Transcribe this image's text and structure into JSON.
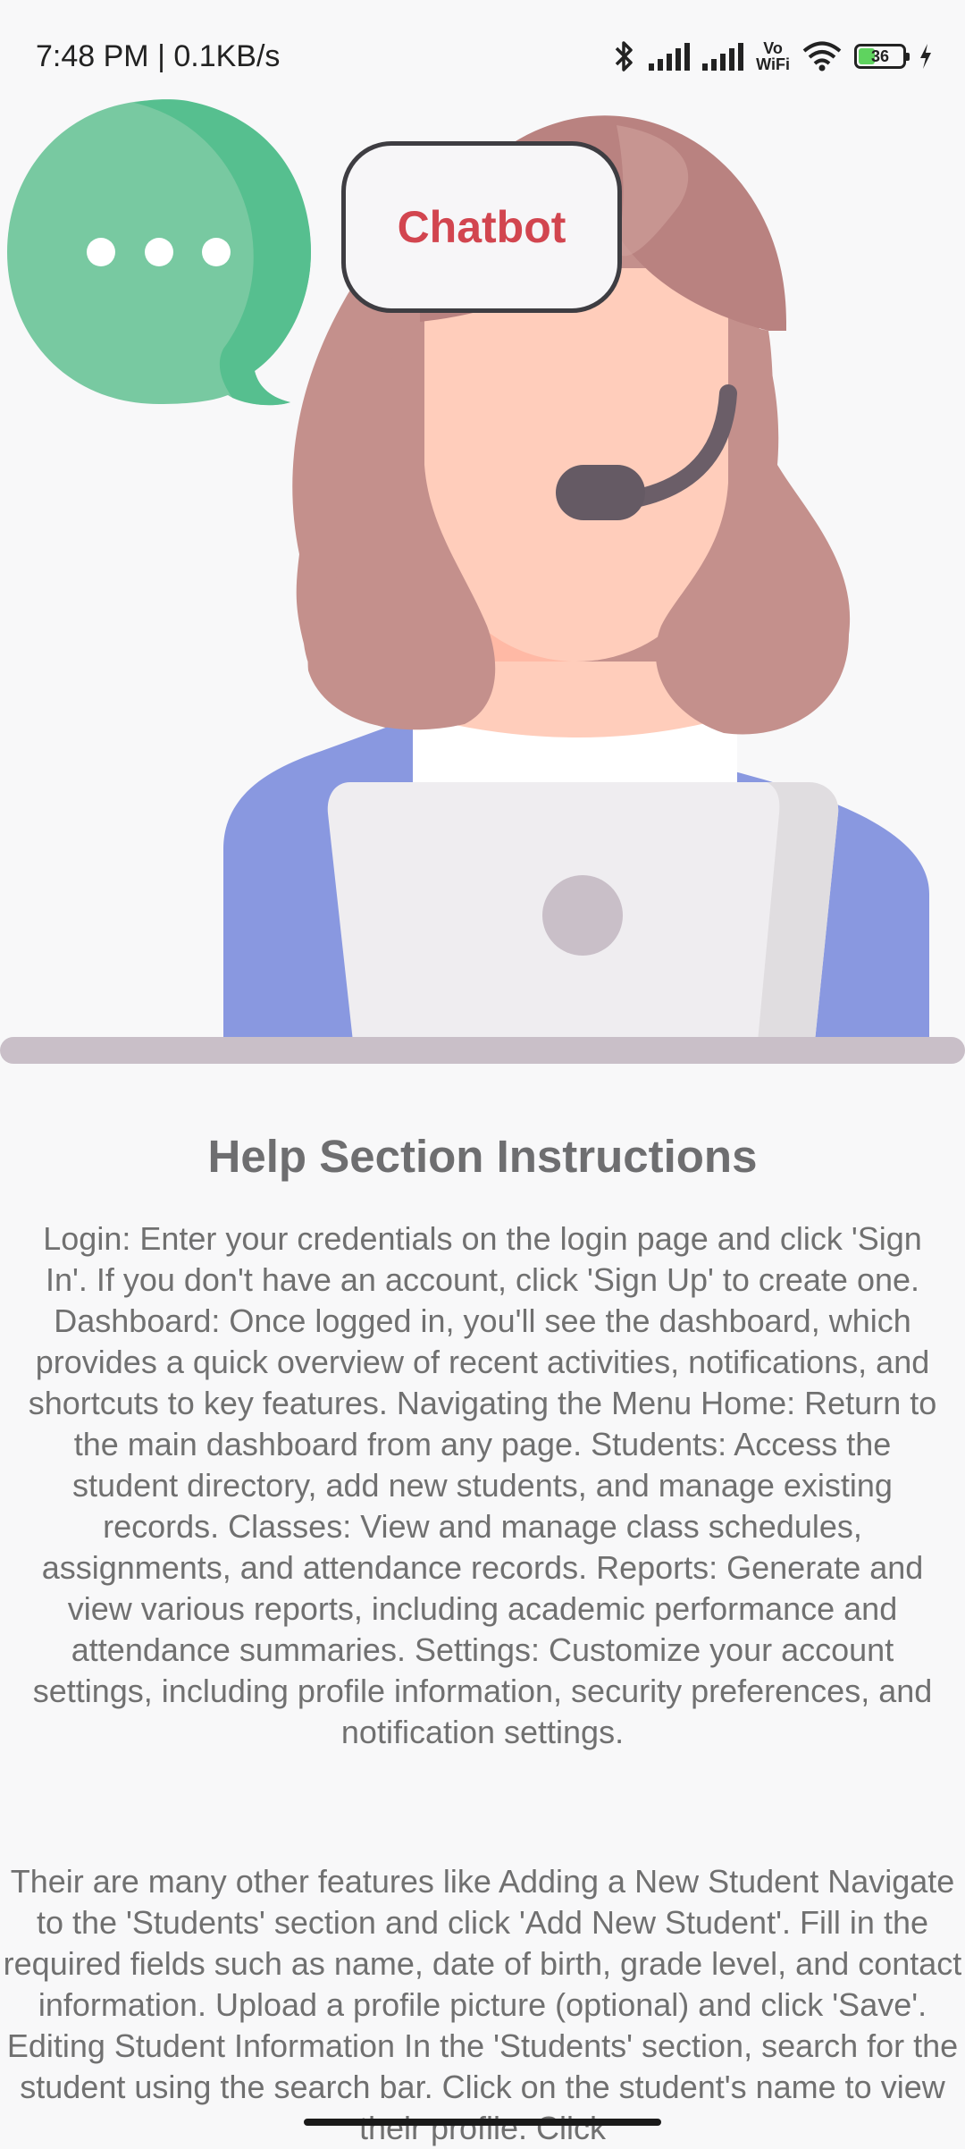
{
  "status_bar": {
    "time": "7:48 PM | 0.1KB/s",
    "vowifi": "Vo\nWiFi",
    "battery": "36",
    "icons": [
      "bluetooth-icon",
      "signal-icon",
      "signal-icon",
      "vowifi-icon",
      "wifi-icon",
      "battery-icon",
      "charging-icon"
    ]
  },
  "hero": {
    "chatbot_label": "Chatbot",
    "colors": {
      "bubble": "#78c9a1",
      "bubble_dark": "#56bf8f",
      "hair": "#c4908c",
      "skin": "#ffcdbb",
      "shirt": "#8998e0",
      "laptop": "#efedf0",
      "desk": "#c9bfc8"
    }
  },
  "help": {
    "title": "Help Section Instructions",
    "paragraph_1": "Login: Enter your credentials on the login page and click 'Sign In'. If you don't have an account, click 'Sign Up' to create one. Dashboard: Once logged in, you'll see the dashboard, which provides a quick overview of recent activities, notifications, and shortcuts to key features. Navigating the Menu  Home: Return to the main dashboard from any page. Students: Access the student directory, add new students, and manage existing records. Classes: View and manage class schedules, assignments, and attendance records. Reports: Generate and view various reports, including academic performance and attendance summaries. Settings: Customize your account settings, including profile information, security preferences, and notification settings.",
    "paragraph_2": "Their are many other features like Adding a New Student  Navigate to the 'Students' section and click 'Add New Student'. Fill in the required fields such as name, date of birth, grade level, and contact information. Upload a profile picture (optional) and click 'Save'. Editing Student Information  In the 'Students' section, search for the student using the search bar. Click on the student's name to view their profile. Click"
  }
}
